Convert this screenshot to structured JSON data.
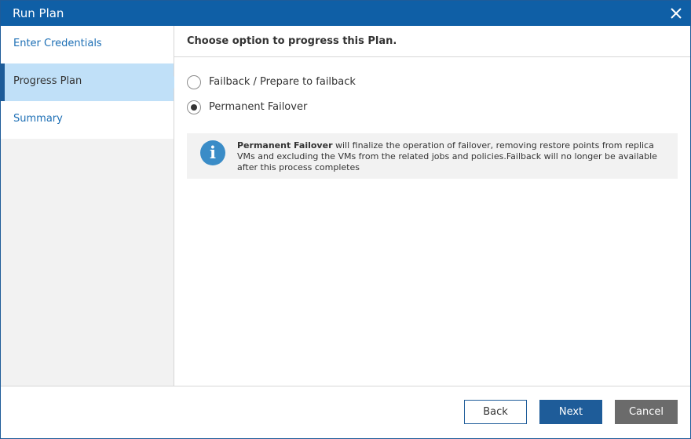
{
  "window": {
    "title": "Run Plan",
    "close_icon": "close-icon"
  },
  "sidebar": {
    "items": [
      {
        "label": "Enter Credentials",
        "active": false
      },
      {
        "label": "Progress Plan",
        "active": true
      },
      {
        "label": "Summary",
        "active": false
      }
    ]
  },
  "main": {
    "heading": "Choose option to progress this Plan.",
    "options": [
      {
        "label": "Failback / Prepare to failback",
        "selected": false
      },
      {
        "label": "Permanent Failover",
        "selected": true
      }
    ],
    "info": {
      "icon": "info-icon",
      "bold": "Permanent Failover",
      "text": " will finalize the operation of failover, removing restore points from replica VMs and excluding the VMs from the related jobs and policies.Failback will no longer be available after this process completes"
    }
  },
  "footer": {
    "back_label": "Back",
    "next_label": "Next",
    "cancel_label": "Cancel"
  },
  "colors": {
    "titlebar": "#0f5fa6",
    "active_step": "#c0e0f8",
    "accent": "#1e5c99",
    "link": "#1d6fb5",
    "info_icon": "#3a8cc7",
    "cancel": "#6b6b6b"
  }
}
